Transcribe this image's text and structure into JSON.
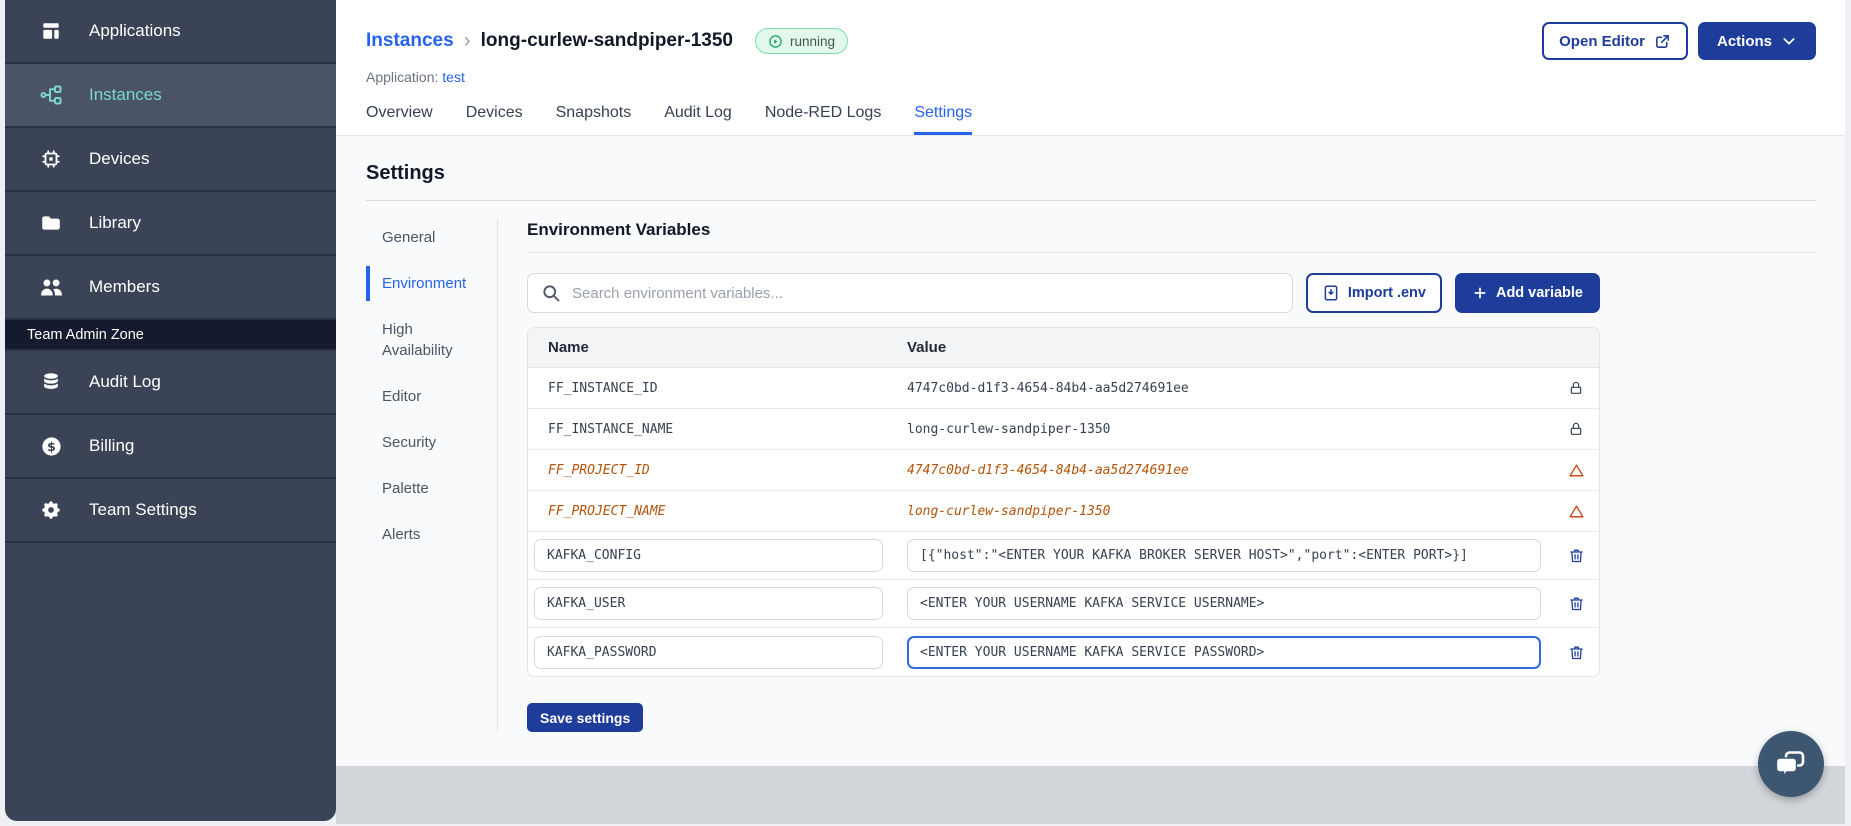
{
  "sidebar": {
    "items": [
      {
        "label": "Applications",
        "active": false
      },
      {
        "label": "Instances",
        "active": true
      },
      {
        "label": "Devices",
        "active": false
      },
      {
        "label": "Library",
        "active": false
      },
      {
        "label": "Members",
        "active": false
      }
    ],
    "section_label": "Team Admin Zone",
    "admin_items": [
      {
        "label": "Audit Log"
      },
      {
        "label": "Billing"
      },
      {
        "label": "Team Settings"
      }
    ]
  },
  "header": {
    "breadcrumb_parent": "Instances",
    "breadcrumb_separator": "›",
    "instance_name": "long-curlew-sandpiper-1350",
    "status": "running",
    "application_label": "Application:",
    "application_name": "test",
    "open_editor": "Open Editor",
    "actions": "Actions"
  },
  "tabs": [
    {
      "label": "Overview",
      "active": false
    },
    {
      "label": "Devices",
      "active": false
    },
    {
      "label": "Snapshots",
      "active": false
    },
    {
      "label": "Audit Log",
      "active": false
    },
    {
      "label": "Node-RED Logs",
      "active": false
    },
    {
      "label": "Settings",
      "active": true
    }
  ],
  "settings": {
    "title": "Settings",
    "subnav": [
      {
        "label": "General",
        "active": false
      },
      {
        "label": "Environment",
        "active": true
      },
      {
        "label": "High Availability",
        "active": false
      },
      {
        "label": "Editor",
        "active": false
      },
      {
        "label": "Security",
        "active": false
      },
      {
        "label": "Palette",
        "active": false
      },
      {
        "label": "Alerts",
        "active": false
      }
    ],
    "env": {
      "title": "Environment Variables",
      "search_placeholder": "Search environment variables...",
      "import_label": "Import .env",
      "add_label": "Add variable",
      "col_name": "Name",
      "col_value": "Value",
      "rows": [
        {
          "name": "FF_INSTANCE_ID",
          "value": "4747c0bd-d1f3-4654-84b4-aa5d274691ee",
          "state": "locked"
        },
        {
          "name": "FF_INSTANCE_NAME",
          "value": "long-curlew-sandpiper-1350",
          "state": "locked"
        },
        {
          "name": "FF_PROJECT_ID",
          "value": "4747c0bd-d1f3-4654-84b4-aa5d274691ee",
          "state": "deprecated"
        },
        {
          "name": "FF_PROJECT_NAME",
          "value": "long-curlew-sandpiper-1350",
          "state": "deprecated"
        },
        {
          "name": "KAFKA_CONFIG",
          "value": "[{\"host\":\"<ENTER YOUR KAFKA BROKER SERVER HOST>\",\"port\":<ENTER PORT>}]",
          "state": "editable"
        },
        {
          "name": "KAFKA_USER",
          "value": "<ENTER YOUR USERNAME KAFKA SERVICE USERNAME>",
          "state": "editable"
        },
        {
          "name": "KAFKA_PASSWORD",
          "value": "<ENTER YOUR USERNAME KAFKA SERVICE PASSWORD>",
          "state": "editable",
          "focused": true
        }
      ],
      "save_label": "Save settings"
    }
  },
  "colors": {
    "brand_navy": "#1e3d9b",
    "link_blue": "#2563eb",
    "sidebar_bg": "#3a4456",
    "sidebar_active_teal": "#79d6d2",
    "warning_orange": "#b45309",
    "running_green": "#17a05e",
    "footer_gray": "#d2d5da"
  }
}
